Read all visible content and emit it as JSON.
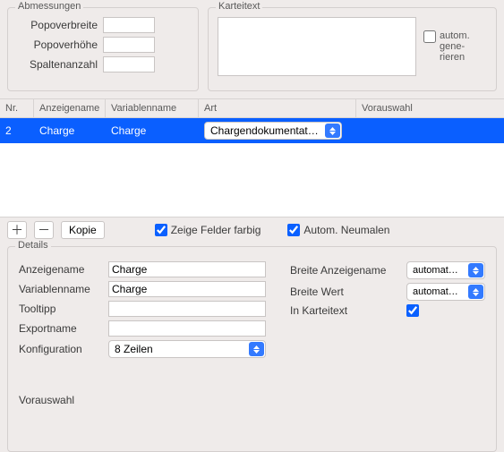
{
  "sections": {
    "abmessungen": {
      "legend": "Abmessungen",
      "popoverbreite_label": "Popoverbreite",
      "popoverhoehe_label": "Popoverhöhe",
      "spaltenanzahl_label": "Spaltenanzahl",
      "popoverbreite_value": "",
      "popoverhoehe_value": "",
      "spaltenanzahl_value": ""
    },
    "karteitext": {
      "legend": "Karteitext",
      "auto_label": "autom. gene-rieren",
      "value": ""
    }
  },
  "table": {
    "headers": {
      "nr": "Nr.",
      "anzeigename": "Anzeigename",
      "variablenname": "Variablenname",
      "art": "Art",
      "vorauswahl": "Vorauswahl"
    },
    "rows": [
      {
        "nr": "2",
        "anzeigename": "Charge",
        "variablenname": "Charge",
        "art": "Chargendokumentat…",
        "vorauswahl": ""
      }
    ]
  },
  "toolbar": {
    "plus": "＋",
    "minus": "－",
    "copy": "Kopie",
    "zeige_farbig": "Zeige Felder farbig",
    "autom_neumalen": "Autom. Neumalen"
  },
  "details": {
    "legend": "Details",
    "anzeigename_label": "Anzeigename",
    "anzeigename_value": "Charge",
    "variablenname_label": "Variablenname",
    "variablenname_value": "Charge",
    "tooltipp_label": "Tooltipp",
    "tooltipp_value": "",
    "exportname_label": "Exportname",
    "exportname_value": "",
    "konfiguration_label": "Konfiguration",
    "konfiguration_value": "8 Zeilen",
    "breite_anzeigename_label": "Breite Anzeigename",
    "breite_anzeigename_value": "automat…",
    "breite_wert_label": "Breite Wert",
    "breite_wert_value": "automat…",
    "in_karteitext_label": "In Karteitext",
    "vorauswahl_label": "Vorauswahl"
  }
}
